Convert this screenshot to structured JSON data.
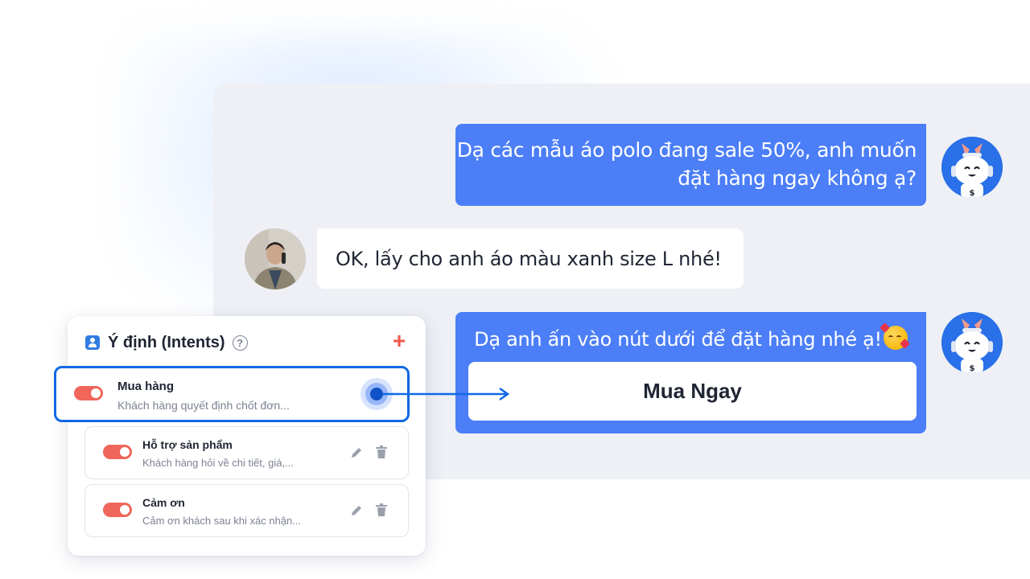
{
  "chat": {
    "bot_message_1_line1": "Dạ các mẫu áo polo đang sale 50%, anh muốn",
    "bot_message_1_line2": "đặt hàng ngay không ạ?",
    "user_message": "OK, lấy cho anh áo màu xanh size L nhé!",
    "bot_message_2": "Dạ anh ấn vào nút dưới để đặt hàng nhé ạ!",
    "bot_message_2_emoji": "smiling-face-with-hearts-icon",
    "buy_button_label": "Mua Ngay",
    "bot_avatar_icon": "robot-avatar",
    "user_avatar_icon": "user-photo-avatar"
  },
  "intents": {
    "title": "Ý định (Intents)",
    "help_icon_glyph": "?",
    "add_icon_glyph": "+",
    "items": [
      {
        "name": "Mua hàng",
        "description": "Khách hàng quyết định chốt đơn...",
        "enabled": true,
        "selected": true
      },
      {
        "name": "Hỗ trợ sản phẩm",
        "description": "Khách hàng hỏi về chi tiết, giá,...",
        "enabled": true,
        "selected": false
      },
      {
        "name": "Cảm ơn",
        "description": "Cảm ơn khách sau khi xác nhận...",
        "enabled": true,
        "selected": false
      }
    ]
  },
  "colors": {
    "bot_bubble": "#4b7ef7",
    "chat_background": "#eef0f5",
    "toggle_on": "#f0665a",
    "selected_border": "#1068e6",
    "add_icon": "#f0574a"
  }
}
